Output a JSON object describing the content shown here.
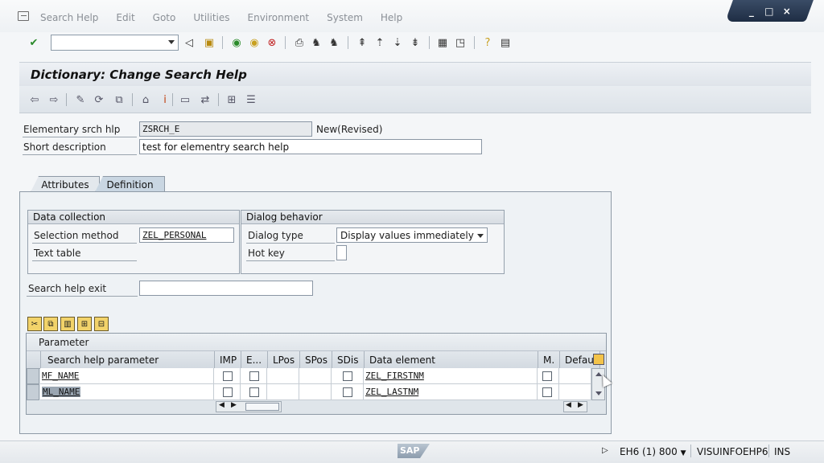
{
  "menubar": {
    "items": [
      "Search Help",
      "Edit",
      "Goto",
      "Utilities",
      "Environment",
      "System",
      "Help"
    ]
  },
  "window_controls": [
    "_",
    "□",
    "×"
  ],
  "header": {
    "title": "Dictionary: Change Search Help"
  },
  "form": {
    "elementary_label": "Elementary srch hlp",
    "elementary_value": "ZSRCH_E",
    "status": "New(Revised)",
    "short_desc_label": "Short description",
    "short_desc_value": "test for elementry search help"
  },
  "tabs": [
    {
      "label": "Attributes",
      "active": false
    },
    {
      "label": "Definition",
      "active": true
    }
  ],
  "data_collection": {
    "title": "Data collection",
    "selection_method_label": "Selection method",
    "selection_method_value": "ZEL_PERSONAL",
    "text_table_label": "Text table"
  },
  "dialog_behavior": {
    "title": "Dialog behavior",
    "dialog_type_label": "Dialog type",
    "dialog_type_value": "Display values immediately",
    "hot_key_label": "Hot key"
  },
  "search_help_exit": {
    "label": "Search help exit",
    "value": ""
  },
  "table": {
    "title": "Parameter",
    "columns": [
      "Search help parameter",
      "IMP",
      "E...",
      "LPos",
      "SPos",
      "SDis",
      "Data element",
      "M.",
      "Defaul"
    ],
    "rows": [
      {
        "param": "MF_NAME",
        "data_element": "ZEL_FIRSTNM"
      },
      {
        "param": "ML_NAME",
        "data_element": "ZEL_LASTNM"
      }
    ]
  },
  "statusbar": {
    "sap": "SAP",
    "system": "EH6 (1) 800",
    "server": "VISUINFOEHP6",
    "mode": "INS"
  },
  "colors": {
    "accent": "#2b3b55",
    "panel": "#eef2f5"
  }
}
